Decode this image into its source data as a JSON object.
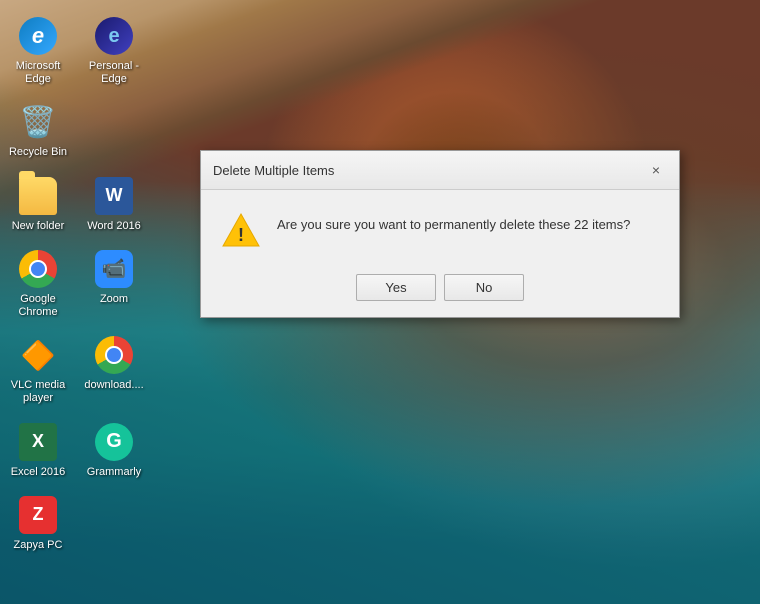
{
  "desktop": {
    "background": "coastal rocks and turquoise water",
    "icons": [
      {
        "id": "microsoft-edge",
        "label": "Microsoft\nEdge",
        "type": "edge"
      },
      {
        "id": "personal-edge",
        "label": "Personal -\nEdge",
        "type": "personal-edge"
      },
      {
        "id": "recycle-bin",
        "label": "Recycle Bin",
        "type": "recycle"
      },
      {
        "id": "new-folder",
        "label": "New folder",
        "type": "folder"
      },
      {
        "id": "word-2016",
        "label": "Word 2016",
        "type": "word"
      },
      {
        "id": "google-chrome",
        "label": "Google\nChrome",
        "type": "chrome"
      },
      {
        "id": "zoom",
        "label": "Zoom",
        "type": "zoom"
      },
      {
        "id": "vlc-media-player",
        "label": "VLC media\nplayer",
        "type": "vlc"
      },
      {
        "id": "download-chrome",
        "label": "download....",
        "type": "download-chrome"
      },
      {
        "id": "excel-2016",
        "label": "Excel 2016",
        "type": "excel"
      },
      {
        "id": "grammarly",
        "label": "Grammarly",
        "type": "grammarly"
      },
      {
        "id": "zapya-pc",
        "label": "Zapya PC",
        "type": "zapya"
      }
    ]
  },
  "dialog": {
    "title": "Delete Multiple Items",
    "message": "Are you sure you want to permanently delete these 22 items?",
    "buttons": {
      "yes": "Yes",
      "no": "No"
    },
    "close_label": "×"
  }
}
